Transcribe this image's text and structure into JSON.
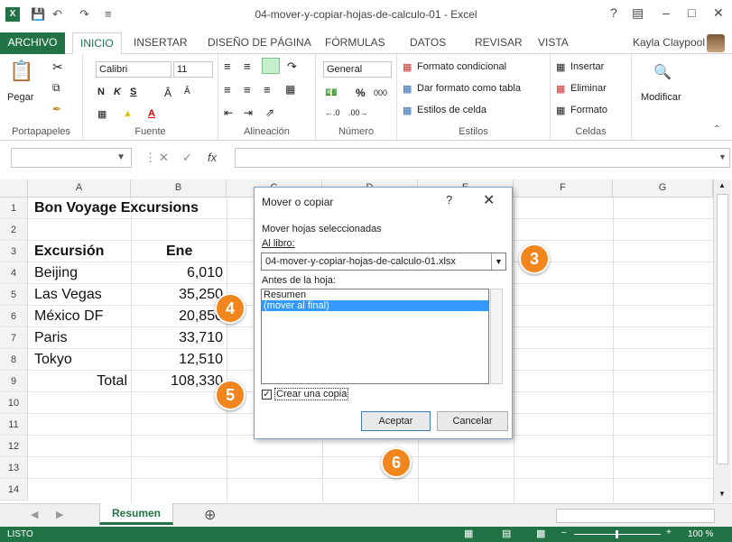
{
  "window": {
    "title": "04-mover-y-copiar-hojas-de-calculo-01 - Excel",
    "help": "?",
    "controls": [
      "–",
      "□",
      "✕"
    ]
  },
  "tabs": [
    "ARCHIVO",
    "INICIO",
    "INSERTAR",
    "DISEÑO DE PÁGINA",
    "FÓRMULAS",
    "DATOS",
    "REVISAR",
    "VISTA"
  ],
  "user": "Kayla Claypool",
  "ribbon": {
    "clipboard": {
      "paste": "Pegar",
      "label": "Portapapeles"
    },
    "font": {
      "name": "Calibri",
      "size": "11",
      "label": "Fuente"
    },
    "alignment": {
      "label": "Alineación"
    },
    "number": {
      "format": "General",
      "label": "Número"
    },
    "styles": {
      "conditional": "Formato condicional",
      "table": "Dar formato como tabla",
      "cell": "Estilos de celda",
      "label": "Estilos"
    },
    "cells": {
      "insert": "Insertar",
      "delete": "Eliminar",
      "format": "Formato",
      "label": "Celdas"
    },
    "editing": {
      "modify": "Modificar"
    }
  },
  "formula_bar": {
    "fx": "fx"
  },
  "grid": {
    "columns": [
      "A",
      "B",
      "C",
      "D",
      "E",
      "F",
      "G"
    ],
    "rows": [
      "1",
      "2",
      "3",
      "4",
      "5",
      "6",
      "7",
      "8",
      "9",
      "10",
      "11",
      "12",
      "13",
      "14"
    ],
    "cells": {
      "title": "Bon Voyage Excursions",
      "h_excursion": "Excursión",
      "h_ene": "Ene",
      "r4a": "Beijing",
      "r4b": "6,010",
      "r5a": "Las Vegas",
      "r5b": "35,250",
      "r6a": "México DF",
      "r6b": "20,850",
      "r7a": "Paris",
      "r7b": "33,710",
      "r8a": "Tokyo",
      "r8b": "12,510",
      "r9a": "Total",
      "r9b": "108,330"
    }
  },
  "sheet_tab": "Resumen",
  "add_sheet": "⊕",
  "status": {
    "left": "LISTO",
    "zoom": "100 %"
  },
  "dialog": {
    "title": "Mover o copiar",
    "help": "?",
    "close": "✕",
    "move_label": "Mover hojas seleccionadas",
    "book_label": "Al libro:",
    "book_value": "04-mover-y-copiar-hojas-de-calculo-01.xlsx",
    "before_label": "Antes de la hoja:",
    "list": [
      "Resumen",
      "(mover al final)"
    ],
    "copy_label": "Crear una copia",
    "ok": "Aceptar",
    "cancel": "Cancelar"
  },
  "callouts": [
    "3",
    "4",
    "5",
    "6"
  ],
  "accent_color": "#217346",
  "callout_color": "#f1861f"
}
